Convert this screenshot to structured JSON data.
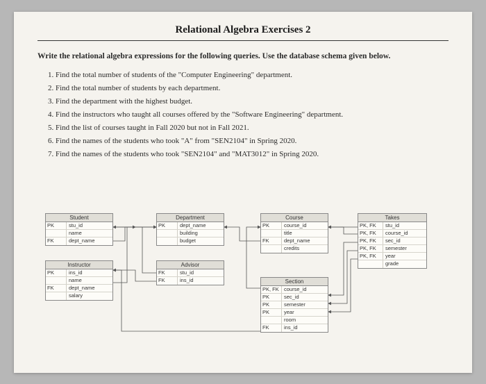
{
  "title": "Relational Algebra Exercises 2",
  "prompt_bold": "Write the relational algebra expressions for the following queries. Use the database schema given below.",
  "queries": [
    "Find the total number of students of the \"Computer Engineering\" department.",
    "Find the total number of students by each department.",
    "Find the department with the highest budget.",
    "Find the instructors who taught all courses offered by the \"Software Engineering\" department.",
    "Find the list of courses taught in Fall 2020 but not in Fall 2021.",
    "Find the names of the students who took \"A\" from \"SEN2104\" in Spring 2020.",
    "Find the names of the students who took \"SEN2104\" and \"MAT3012\" in Spring 2020."
  ],
  "tables": {
    "student": {
      "name": "Student",
      "rows": [
        {
          "k": "PK",
          "c": "stu_id"
        },
        {
          "k": "",
          "c": "name"
        },
        {
          "k": "FK",
          "c": "dept_name"
        }
      ]
    },
    "instructor": {
      "name": "Instructor",
      "rows": [
        {
          "k": "PK",
          "c": "ins_id"
        },
        {
          "k": "",
          "c": "name"
        },
        {
          "k": "FK",
          "c": "dept_name"
        },
        {
          "k": "",
          "c": "salary"
        }
      ]
    },
    "department": {
      "name": "Department",
      "rows": [
        {
          "k": "PK",
          "c": "dept_name"
        },
        {
          "k": "",
          "c": "building"
        },
        {
          "k": "",
          "c": "budget"
        }
      ]
    },
    "advisor": {
      "name": "Advisor",
      "rows": [
        {
          "k": "FK",
          "c": "stu_id"
        },
        {
          "k": "FK",
          "c": "ins_id"
        }
      ]
    },
    "course": {
      "name": "Course",
      "rows": [
        {
          "k": "PK",
          "c": "course_id"
        },
        {
          "k": "",
          "c": "title"
        },
        {
          "k": "FK",
          "c": "dept_name"
        },
        {
          "k": "",
          "c": "credits"
        }
      ]
    },
    "section": {
      "name": "Section",
      "rows": [
        {
          "k": "PK, FK",
          "c": "course_id"
        },
        {
          "k": "PK",
          "c": "sec_id"
        },
        {
          "k": "PK",
          "c": "semester"
        },
        {
          "k": "PK",
          "c": "year"
        },
        {
          "k": "",
          "c": "room"
        },
        {
          "k": "FK",
          "c": "ins_id"
        }
      ]
    },
    "takes": {
      "name": "Takes",
      "rows": [
        {
          "k": "PK, FK",
          "c": "stu_id"
        },
        {
          "k": "PK, FK",
          "c": "course_id"
        },
        {
          "k": "PK, FK",
          "c": "sec_id"
        },
        {
          "k": "PK, FK",
          "c": "semester"
        },
        {
          "k": "PK, FK",
          "c": "year"
        },
        {
          "k": "",
          "c": "grade"
        }
      ]
    }
  }
}
